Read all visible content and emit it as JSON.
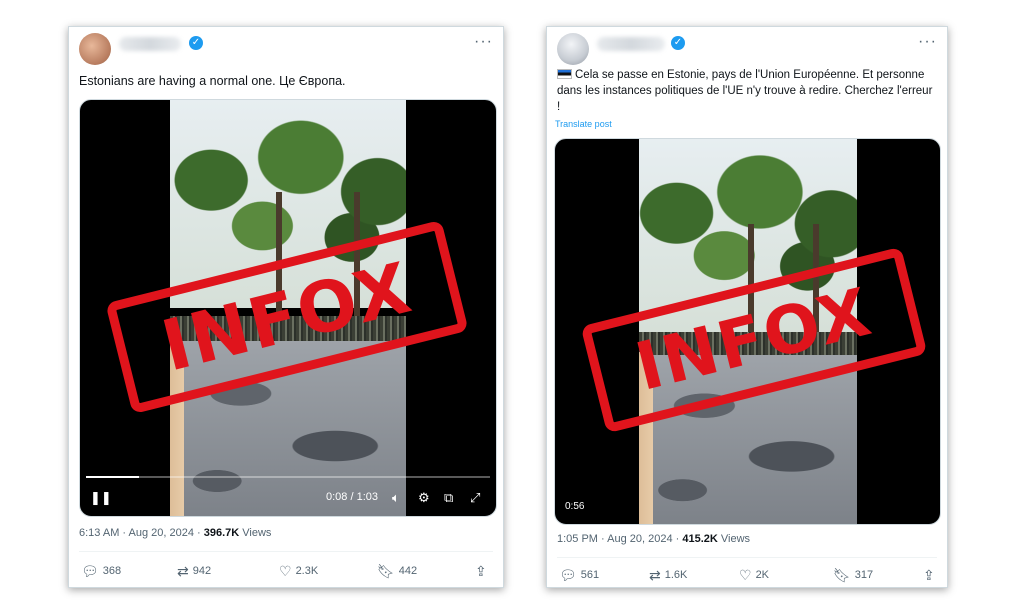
{
  "posts": [
    {
      "text": "Estonians are having a normal one. Це Європа.",
      "stamp": "INFOX",
      "video": {
        "elapsed": "0:08",
        "duration": "1:03",
        "progress": 0.13
      },
      "time": "6:13 AM · Aug 20, 2024 · ",
      "views_count": "396.7K",
      "views_label": " Views",
      "actions": {
        "replies": "368",
        "reposts": "942",
        "likes": "2.3K",
        "bookmarks": "442"
      },
      "icons": [
        "verified-icon",
        "more-icon",
        "pause-icon",
        "volume-icon",
        "settings-icon",
        "pip-icon",
        "fullscreen-icon",
        "reply-icon",
        "repost-icon",
        "like-icon",
        "bookmark-icon",
        "share-icon"
      ]
    },
    {
      "text": "Cela se passe en Estonie, pays de l'Union Européenne. Et personne dans les instances politiques de l'UE n'y trouve à redire. Cherchez l'erreur !",
      "translate": "Translate post",
      "stamp": "INFOX",
      "video": {
        "duration": "0:56"
      },
      "time": "1:05 PM · Aug 20, 2024 · ",
      "views_count": "415.2K",
      "views_label": " Views",
      "actions": {
        "replies": "561",
        "reposts": "1.6K",
        "likes": "2K",
        "bookmarks": "317"
      }
    }
  ],
  "colors": {
    "stamp": "#e0141c",
    "accent": "#1d9bf0"
  }
}
